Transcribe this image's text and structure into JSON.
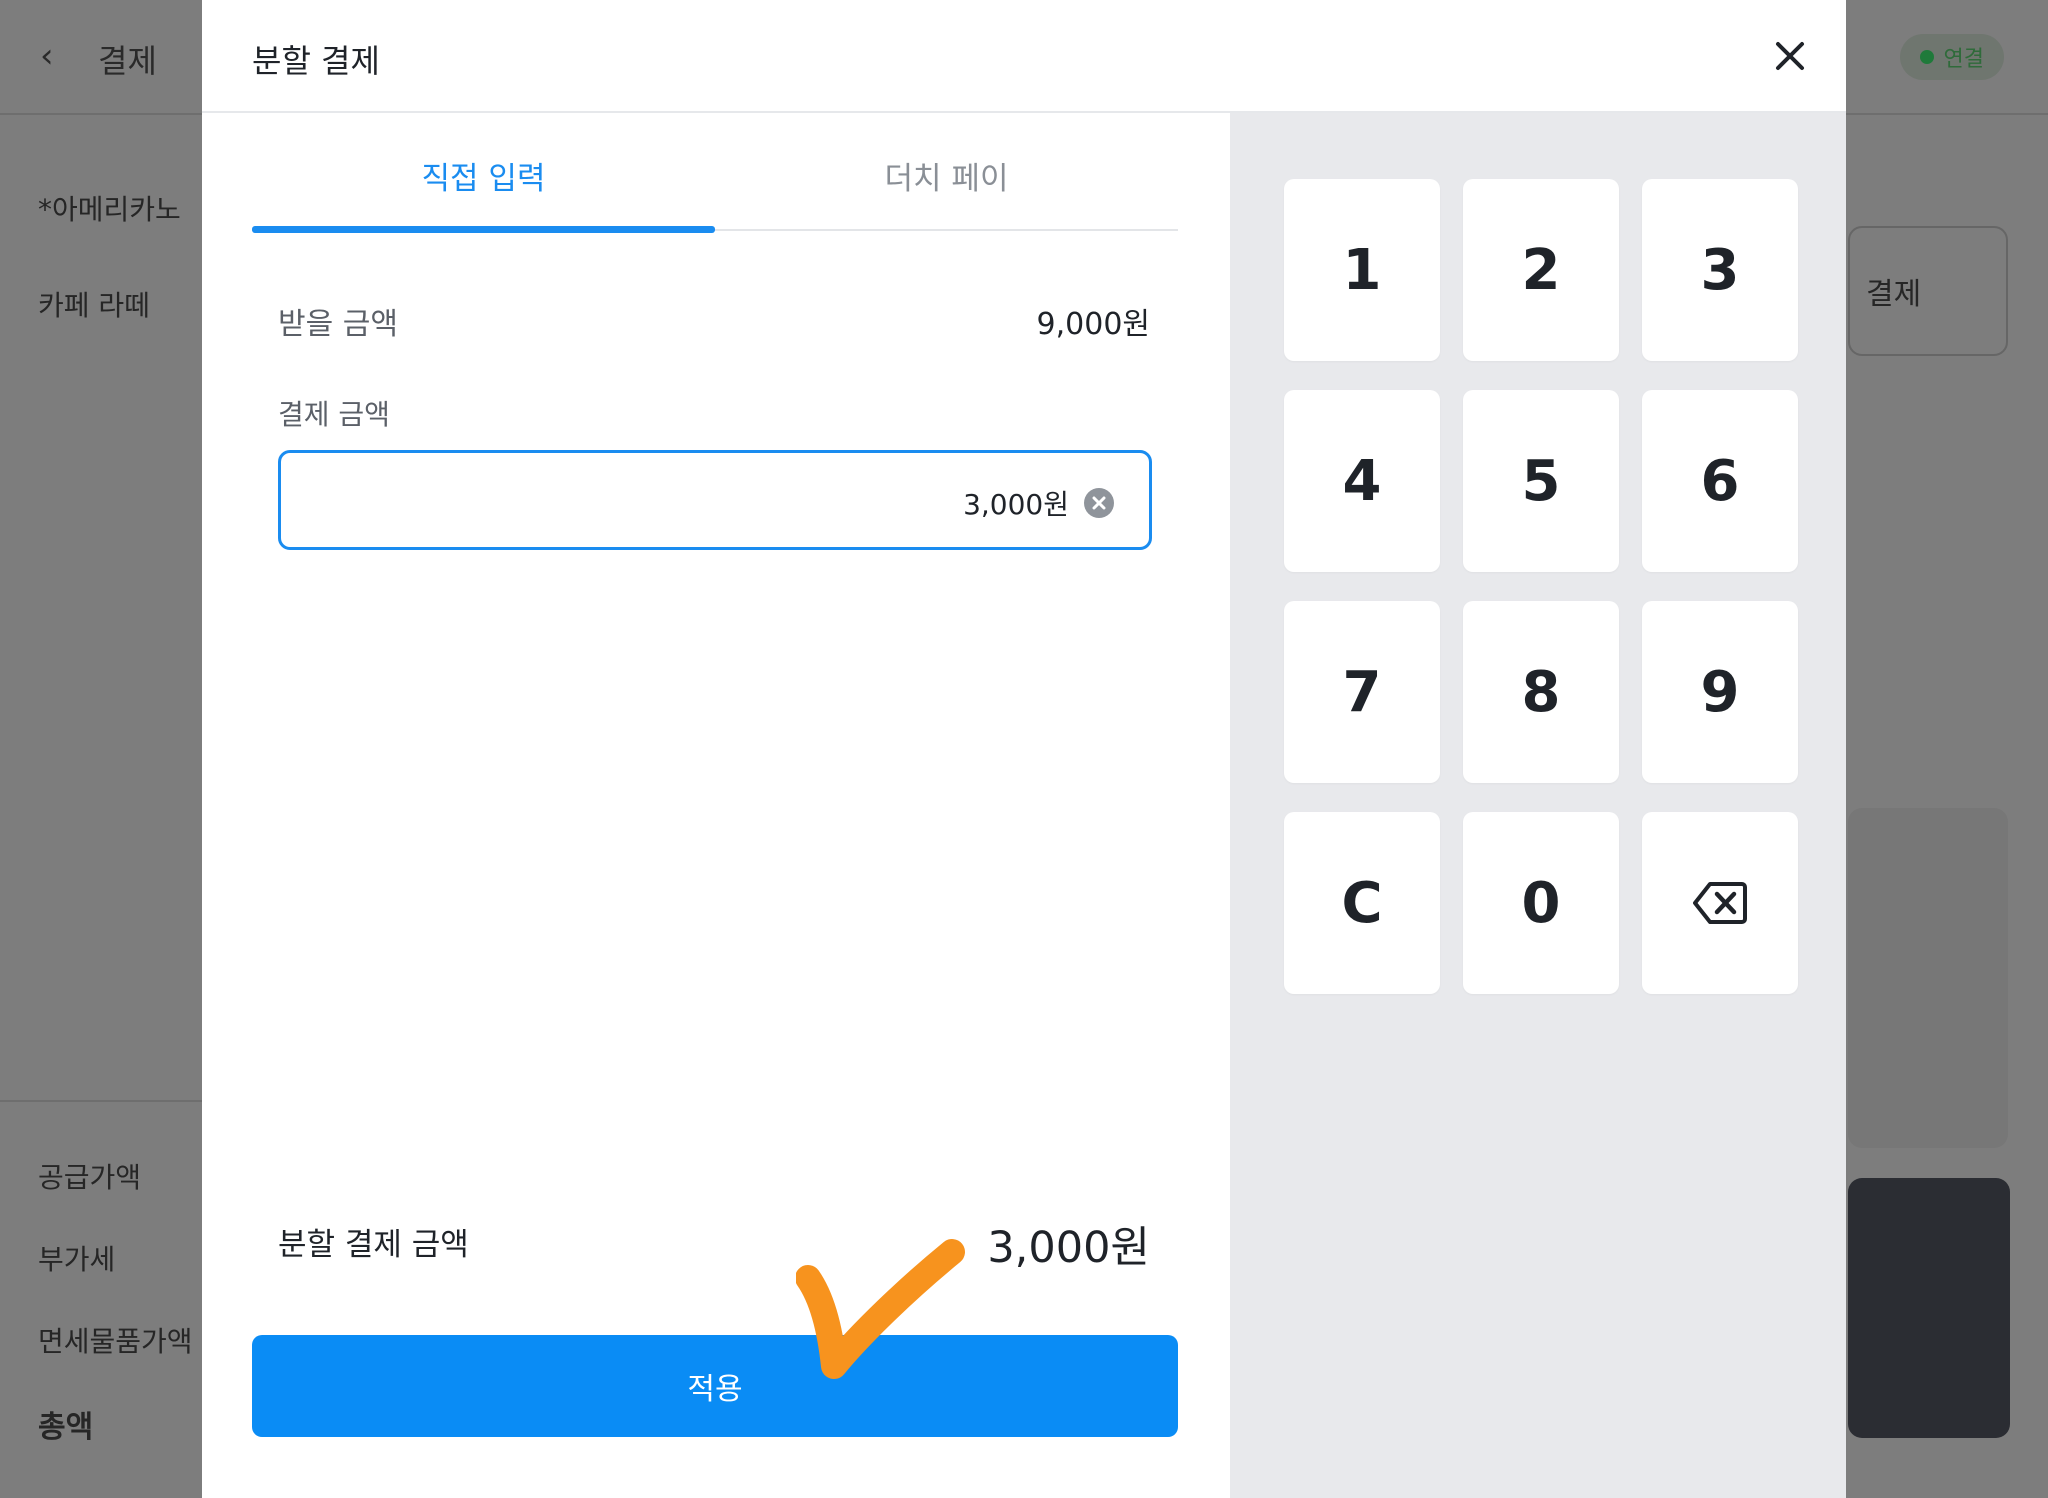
{
  "background": {
    "header": {
      "back_icon": "chevron-left-icon",
      "title": "결제",
      "status_label": "연결",
      "status_color": "#1f7a3a"
    },
    "menu_items": [
      "*아메리카노",
      "카페 라떼"
    ],
    "summary": [
      "공급가액",
      "부가세",
      "면세물품가액",
      "총액"
    ],
    "method_label": "결제"
  },
  "modal": {
    "title": "분할 결제",
    "close_icon": "close-icon",
    "tabs": [
      {
        "label": "직접 입력",
        "active": true
      },
      {
        "label": "더치 페이",
        "active": false
      }
    ],
    "receive_label": "받을 금액",
    "receive_value": "9,000원",
    "payment_label": "결제 금액",
    "payment_value": "3,000원",
    "clear_icon": "clear-circle-icon",
    "split_label": "분할 결제 금액",
    "split_value": "3,000원",
    "apply_label": "적용",
    "accent_color": "#1a8cf0"
  },
  "keypad": {
    "keys": [
      "1",
      "2",
      "3",
      "4",
      "5",
      "6",
      "7",
      "8",
      "9",
      "C",
      "0",
      ""
    ],
    "backspace_icon": "backspace-icon"
  },
  "annotation": {
    "icon": "checkmark-annotation-icon",
    "color": "#f7931e"
  }
}
